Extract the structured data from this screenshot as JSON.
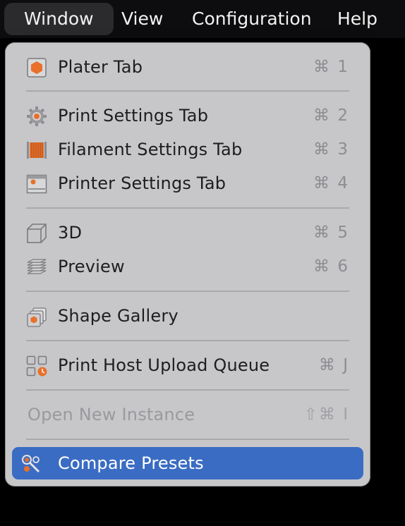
{
  "menubar": {
    "items": [
      {
        "label": "Window",
        "active": true
      },
      {
        "label": "View"
      },
      {
        "label": "Configuration"
      },
      {
        "label": "Help"
      }
    ]
  },
  "menu": {
    "items": [
      {
        "label": "Plater Tab",
        "shortcut": "⌘ 1",
        "icon": "plater-icon"
      },
      {
        "label": "Print Settings Tab",
        "shortcut": "⌘ 2",
        "icon": "gear-icon"
      },
      {
        "label": "Filament Settings Tab",
        "shortcut": "⌘ 3",
        "icon": "filament-icon"
      },
      {
        "label": "Printer Settings Tab",
        "shortcut": "⌘ 4",
        "icon": "printer-icon"
      },
      {
        "label": "3D",
        "shortcut": "⌘ 5",
        "icon": "cube-icon"
      },
      {
        "label": "Preview",
        "shortcut": "⌘ 6",
        "icon": "layers-icon"
      },
      {
        "label": "Shape Gallery",
        "shortcut": "",
        "icon": "shape-gallery-icon"
      },
      {
        "label": "Print Host Upload Queue",
        "shortcut": "⌘ J",
        "icon": "upload-queue-icon"
      },
      {
        "label": "Open New Instance",
        "shortcut": "⇧⌘ I",
        "disabled": true
      },
      {
        "label": "Compare Presets",
        "shortcut": "",
        "icon": "compare-icon",
        "highlighted": true
      }
    ]
  },
  "colors": {
    "accent_orange": "#e8702a",
    "highlight_blue": "#3a6cc3",
    "menu_background": "#c7c7ca"
  }
}
